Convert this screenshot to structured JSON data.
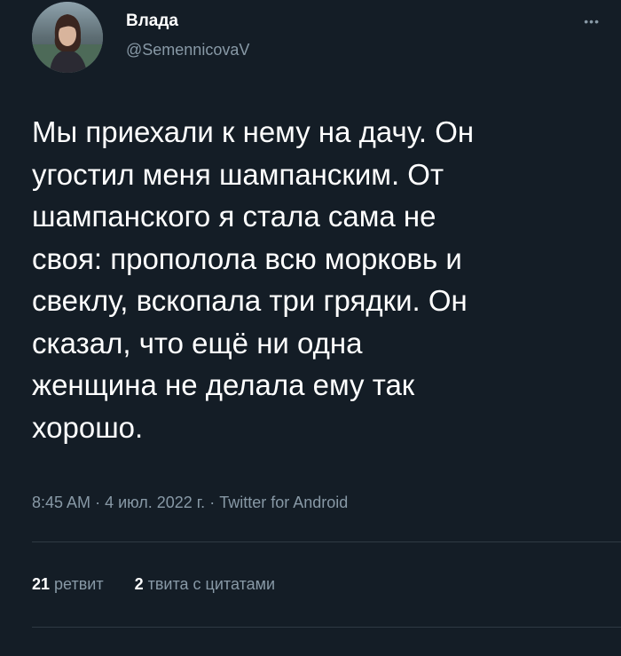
{
  "author": {
    "display_name": "Влада",
    "handle": "@SemennicovaV"
  },
  "tweet": {
    "text": "Мы приехали к нему на дачу. Он\nугостил меня шампанским. От\nшампанского я стала сама не\nсвоя: прополола всю морковь и\nсвеклу, вскопала три грядки. Он\nсказал, что ещё ни одна\nженщина не делала ему так\nхорошо.",
    "time": "8:45 AM",
    "date": "4 июл. 2022 г.",
    "source": "Twitter for Android",
    "separator": "·"
  },
  "stats": {
    "retweets_count": "21",
    "retweets_label": "ретвит",
    "quotes_count": "2",
    "quotes_label": "твита с цитатами"
  },
  "icons": {
    "more": "more-dots-icon"
  },
  "colors": {
    "background": "#141d26",
    "secondary_text": "#8899a6",
    "divider": "#2f3a44"
  }
}
